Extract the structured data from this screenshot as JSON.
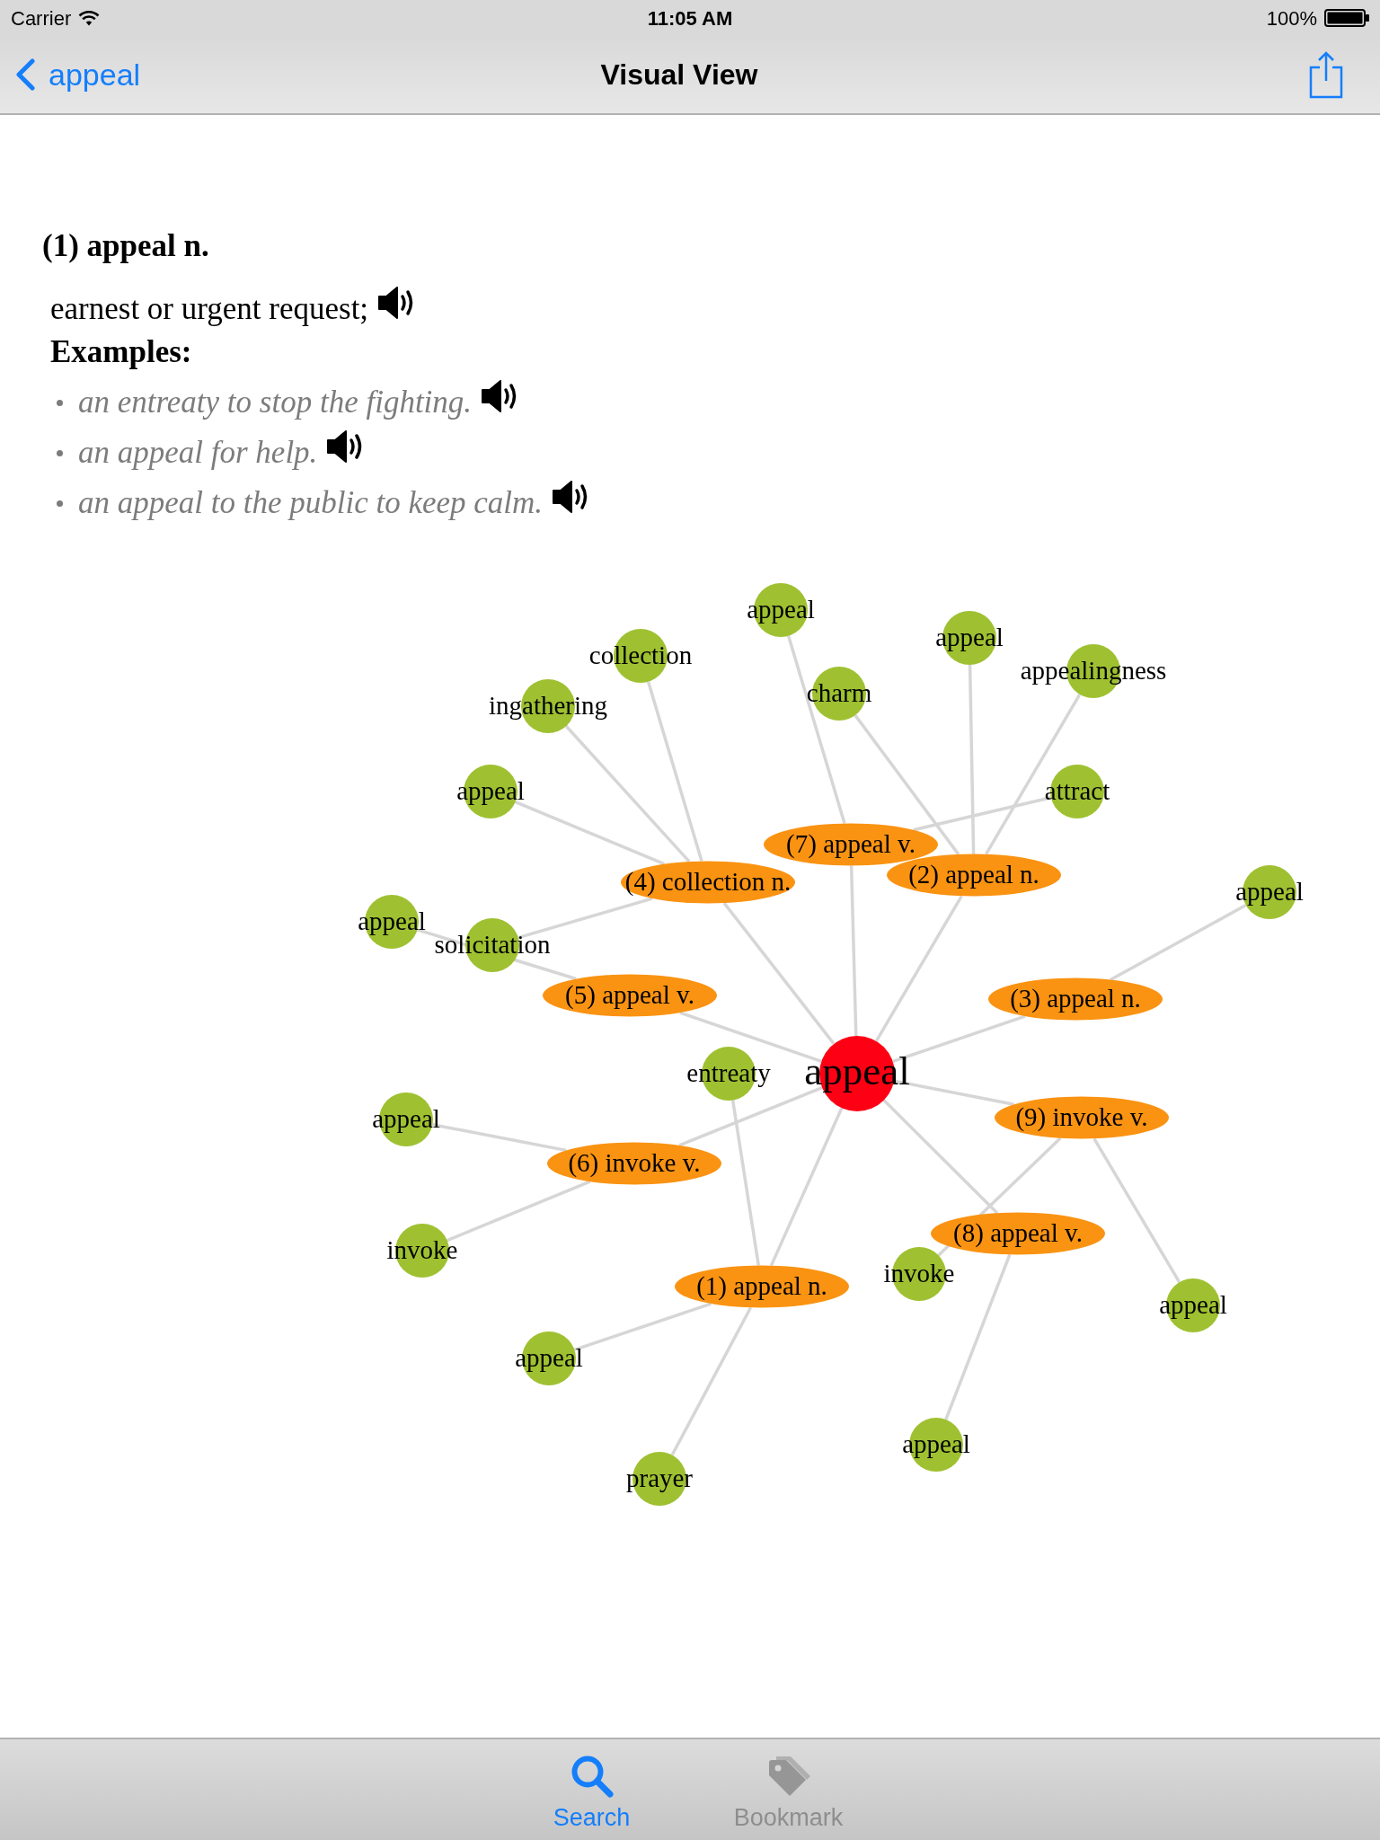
{
  "status_bar": {
    "carrier": "Carrier",
    "time": "11:05 AM",
    "battery": "100%"
  },
  "nav_bar": {
    "back": "appeal",
    "title": "Visual View"
  },
  "entry": {
    "heading": "(1) appeal n.",
    "definition": "earnest or urgent request;",
    "examples_label": "Examples:",
    "examples": [
      "an entreaty to stop the fighting.",
      "an appeal for help.",
      "an appeal to the public to keep calm."
    ]
  },
  "graph": {
    "center": "appeal",
    "senses": [
      {
        "label": "(7) appeal v.",
        "children": [
          {
            "label": "appeal"
          },
          {
            "label": "attract"
          }
        ]
      },
      {
        "label": "(4) collection n.",
        "children": [
          {
            "label": "collection"
          },
          {
            "label": "ingathering"
          },
          {
            "label": "appeal"
          },
          {
            "label": "solicitation"
          }
        ]
      },
      {
        "label": "(2) appeal n.",
        "children": [
          {
            "label": "appeal"
          },
          {
            "label": "appealingness"
          },
          {
            "label": "charm"
          }
        ]
      },
      {
        "label": "(5) appeal v.",
        "children": [
          {
            "label": "appeal"
          }
        ]
      },
      {
        "label": "(3) appeal n.",
        "children": [
          {
            "label": "appeal"
          }
        ]
      },
      {
        "label": "(6) invoke v.",
        "children": [
          {
            "label": "appeal"
          },
          {
            "label": "invoke"
          }
        ]
      },
      {
        "label": "(1) appeal n.",
        "children": [
          {
            "label": "entreaty"
          },
          {
            "label": "appeal"
          },
          {
            "label": "prayer"
          }
        ]
      },
      {
        "label": "(9) invoke v.",
        "children": [
          {
            "label": "invoke"
          },
          {
            "label": "appeal"
          }
        ]
      },
      {
        "label": "(8) appeal v.",
        "children": [
          {
            "label": "appeal"
          }
        ]
      }
    ]
  },
  "tab_bar": {
    "tabs": [
      {
        "label": "Search",
        "selected": true
      },
      {
        "label": "Bookmark",
        "selected": false
      }
    ]
  }
}
